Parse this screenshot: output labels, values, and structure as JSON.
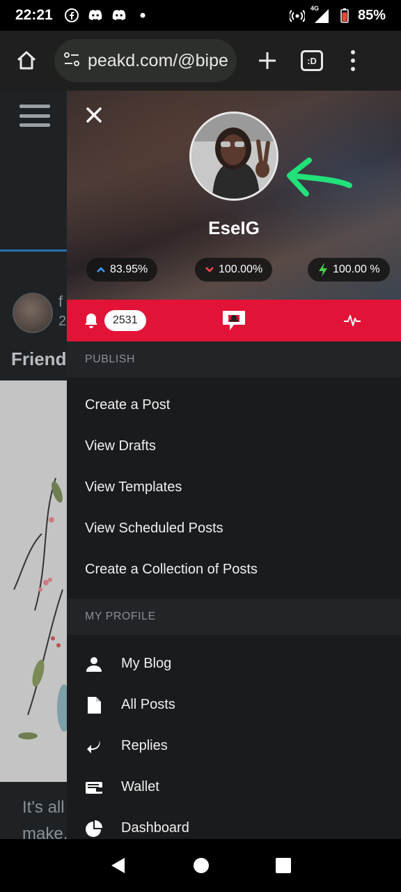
{
  "status_bar": {
    "time": "22:21",
    "network": "4G",
    "battery": "85%"
  },
  "browser": {
    "url": "peakd.com/@bipe",
    "tab_label": ":D"
  },
  "background_page": {
    "author_initial": "f",
    "date_initial": "2",
    "post_title": "Friend",
    "snippet_line1": "It's all",
    "snippet_line2": "make."
  },
  "drawer": {
    "username": "EseIG",
    "stats": {
      "upvote_power": "83.95%",
      "downvote_power": "100.00%",
      "resource_credits": "100.00 %"
    },
    "notification_count": "2531",
    "sections": {
      "publish": {
        "title": "PUBLISH",
        "items": [
          "Create a Post",
          "View Drafts",
          "View Templates",
          "View Scheduled Posts",
          "Create a Collection of Posts"
        ]
      },
      "my_profile": {
        "title": "MY PROFILE",
        "items": [
          {
            "label": "My Blog",
            "icon": "user-icon"
          },
          {
            "label": "All Posts",
            "icon": "document-icon"
          },
          {
            "label": "Replies",
            "icon": "reply-icon"
          },
          {
            "label": "Wallet",
            "icon": "wallet-icon"
          },
          {
            "label": "Dashboard",
            "icon": "pie-chart-icon"
          }
        ]
      }
    }
  },
  "colors": {
    "brand_red": "#e31337",
    "annotation_green": "#22e07a",
    "upvote_blue": "#3b9eff",
    "downvote_red": "#ff4a4a",
    "rc_green": "#4cd04c"
  }
}
